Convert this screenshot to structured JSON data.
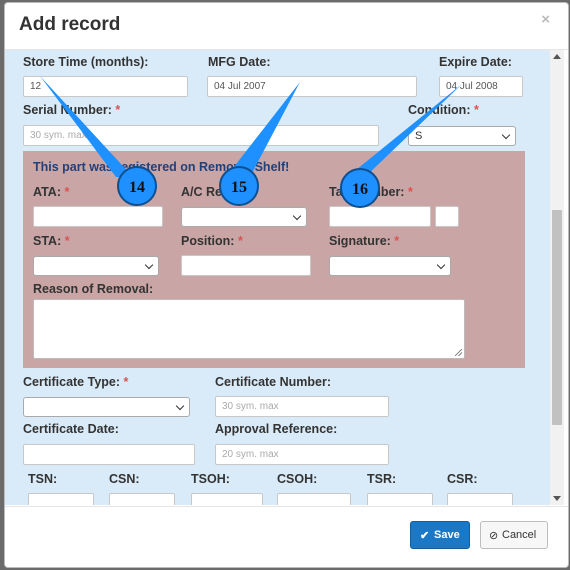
{
  "modal": {
    "title": "Add record",
    "close_label": "×"
  },
  "form": {
    "store_time": {
      "label": "Store Time (months):",
      "value": "12"
    },
    "mfg_date": {
      "label": "MFG Date:",
      "value": "04 Jul 2007"
    },
    "expire_date": {
      "label": "Expire Date:",
      "value": "04 Jul 2008"
    },
    "serial_number": {
      "label": "Serial Number:",
      "required_mark": "*",
      "placeholder": "30 sym. max"
    },
    "condition": {
      "label": "Condition:",
      "required_mark": "*",
      "value": "S"
    },
    "install_section": {
      "message": "This part was registered on Removal Shelf!",
      "ata": {
        "label": "ATA:",
        "required_mark": "*"
      },
      "ac_reg": {
        "label": "A/C Reg:",
        "required_mark": "*"
      },
      "tail_number": {
        "label": "Tail Number:",
        "required_mark": "*"
      },
      "sta": {
        "label": "STA:",
        "required_mark": "*"
      },
      "position": {
        "label": "Position:",
        "required_mark": "*"
      },
      "signature": {
        "label": "Signature:",
        "required_mark": "*"
      },
      "reason_of_removal": {
        "label": "Reason of Removal:"
      }
    },
    "certificate_type": {
      "label": "Certificate Type:",
      "required_mark": "*"
    },
    "certificate_number": {
      "label": "Certificate Number:",
      "placeholder": "30 sym. max"
    },
    "certificate_date": {
      "label": "Certificate Date:"
    },
    "approval_reference": {
      "label": "Approval Reference:",
      "placeholder": "20 sym. max"
    },
    "counters": {
      "tsn": "TSN:",
      "csn": "CSN:",
      "tsoh": "TSOH:",
      "csoh": "CSOH:",
      "tsr": "TSR:",
      "csr": "CSR:"
    }
  },
  "footer": {
    "save_label": "Save",
    "cancel_label": "Cancel"
  },
  "callouts": [
    "14",
    "15",
    "16"
  ],
  "colors": {
    "form_bg": "#d9ebf8",
    "install_section_bg": "#c9a5a6",
    "callout_blue": "#1e90ff",
    "save_blue": "#1b78c6",
    "required_red": "#d9534f"
  }
}
